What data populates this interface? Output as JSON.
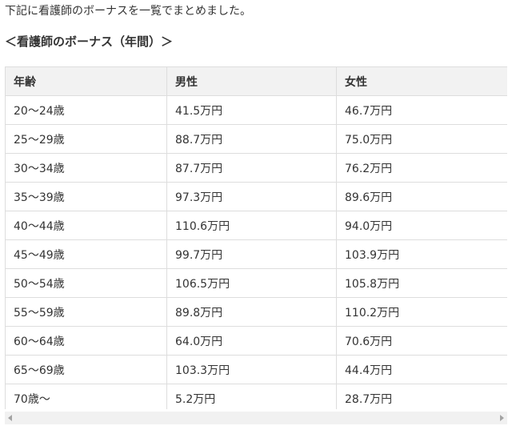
{
  "intro_text": "下記に看護師のボーナスを一覧でまとめました。",
  "section_heading": "＜看護師のボーナス（年間）＞",
  "table": {
    "headers": [
      "年齢",
      "男性",
      "女性"
    ],
    "rows": [
      [
        "20～24歳",
        "41.5万円",
        "46.7万円"
      ],
      [
        "25～29歳",
        "88.7万円",
        "75.0万円"
      ],
      [
        "30～34歳",
        "87.7万円",
        "76.2万円"
      ],
      [
        "35～39歳",
        "97.3万円",
        "89.6万円"
      ],
      [
        "40～44歳",
        "110.6万円",
        "94.0万円"
      ],
      [
        "45～49歳",
        "99.7万円",
        "103.9万円"
      ],
      [
        "50～54歳",
        "106.5万円",
        "105.8万円"
      ],
      [
        "55～59歳",
        "89.8万円",
        "110.2万円"
      ],
      [
        "60～64歳",
        "64.0万円",
        "70.6万円"
      ],
      [
        "65～69歳",
        "103.3万円",
        "44.4万円"
      ],
      [
        "70歳～",
        "5.2万円",
        "28.7万円"
      ]
    ]
  },
  "colors": {
    "text": "#333333",
    "header_bg": "#f2f2f2",
    "border": "#dddddd",
    "scrollbar_track": "#f1f1f1",
    "scrollbar_arrow": "#a3a3a3"
  }
}
